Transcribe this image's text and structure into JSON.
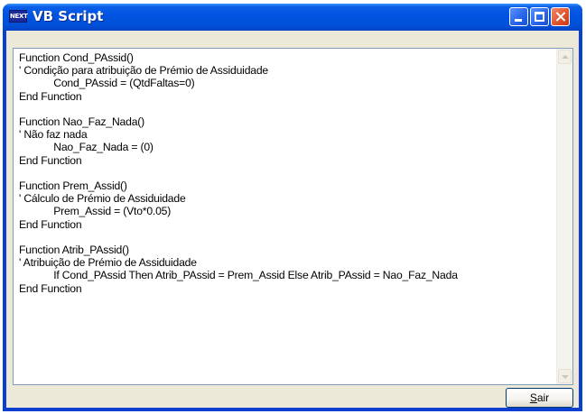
{
  "window": {
    "icon_text": "NEXT",
    "title": "VB Script"
  },
  "editor": {
    "code": "Function Cond_PAssid()\n' Condição para atribuição de Prémio de Assiduidade\n            Cond_PAssid = (QtdFaltas=0)\nEnd Function\n\nFunction Nao_Faz_Nada()\n' Não faz nada\n            Nao_Faz_Nada = (0)\nEnd Function\n\nFunction Prem_Assid()\n' Cálculo de Prémio de Assiduidade\n            Prem_Assid = (Vto*0.05)\nEnd Function\n\nFunction Atrib_PAssid()\n' Atribuição de Prémio de Assiduidade\n            If Cond_PAssid Then Atrib_PAssid = Prem_Assid Else Atrib_PAssid = Nao_Faz_Nada\nEnd Function"
  },
  "buttons": {
    "sair_mnemonic": "S",
    "sair_rest": "air"
  }
}
